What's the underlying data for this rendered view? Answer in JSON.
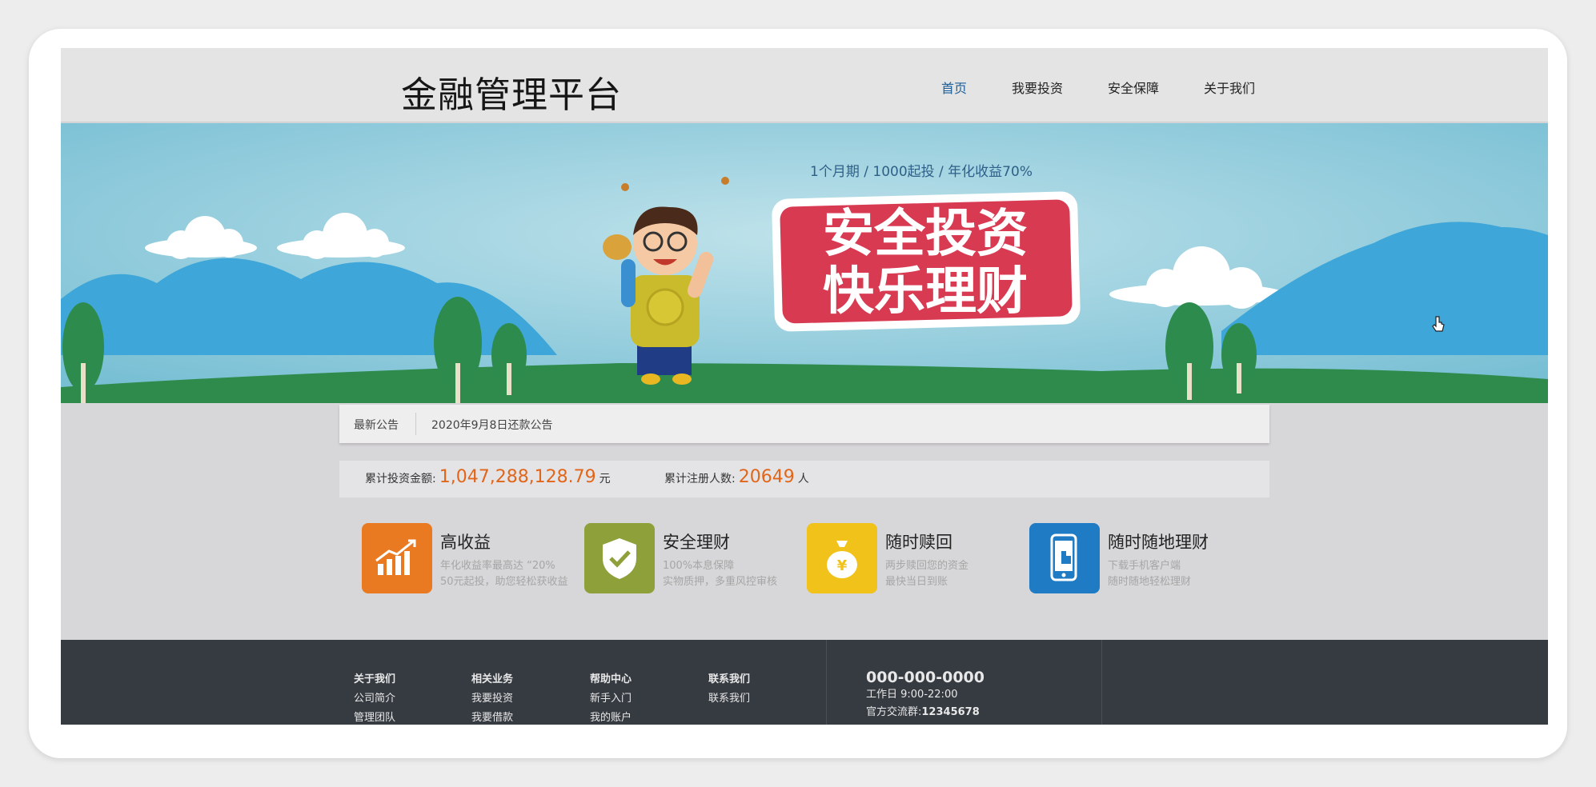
{
  "header": {
    "logo": "金融管理平台",
    "nav": [
      "首页",
      "我要投资",
      "安全保障",
      "关于我们"
    ]
  },
  "banner": {
    "tagline": "1个月期 / 1000起投 / 年化收益70%",
    "headline_1": "安全投资",
    "headline_2": "快乐理财"
  },
  "notice": {
    "label": "最新公告",
    "text": "2020年9月8日还款公告"
  },
  "stats": {
    "invest_label": "累计投资金额:",
    "invest_value": "1,047,288,128.79",
    "invest_unit": "元",
    "users_label": "累计注册人数:",
    "users_value": "20649",
    "users_unit": "人"
  },
  "features": [
    {
      "title": "高收益",
      "desc1": "年化收益率最高达 “20%",
      "desc2": "50元起投，助您轻松获收益",
      "color": "#ea7a22",
      "icon": "chart-icon"
    },
    {
      "title": "安全理财",
      "desc1": "100%本息保障",
      "desc2": "实物质押，多重风控审核",
      "color": "#8ea03a",
      "icon": "shield-check-icon"
    },
    {
      "title": "随时赎回",
      "desc1": "两步赎回您的资金",
      "desc2": "最快当日到账",
      "color": "#f0c21a",
      "icon": "money-bag-icon"
    },
    {
      "title": "随时随地理财",
      "desc1": "下载手机客户端",
      "desc2": "随时随地轻松理财",
      "color": "#1f7bc4",
      "icon": "mobile-icon"
    }
  ],
  "footer": {
    "columns": [
      {
        "title": "关于我们",
        "items": [
          "公司简介",
          "管理团队"
        ]
      },
      {
        "title": "相关业务",
        "items": [
          "我要投资",
          "我要借款"
        ]
      },
      {
        "title": "帮助中心",
        "items": [
          "新手入门",
          "我的账户"
        ]
      },
      {
        "title": "联系我们",
        "items": [
          "联系我们"
        ]
      }
    ],
    "phone": "000-000-0000",
    "hours": "工作日 9:00-22:00",
    "group_label": "官方交流群:",
    "group_number": "12345678"
  },
  "colors": {
    "accent_orange": "#e2661a",
    "nav_active": "#1a5f9b",
    "footer_bg": "#363a41",
    "sky": "#88c6d8"
  }
}
